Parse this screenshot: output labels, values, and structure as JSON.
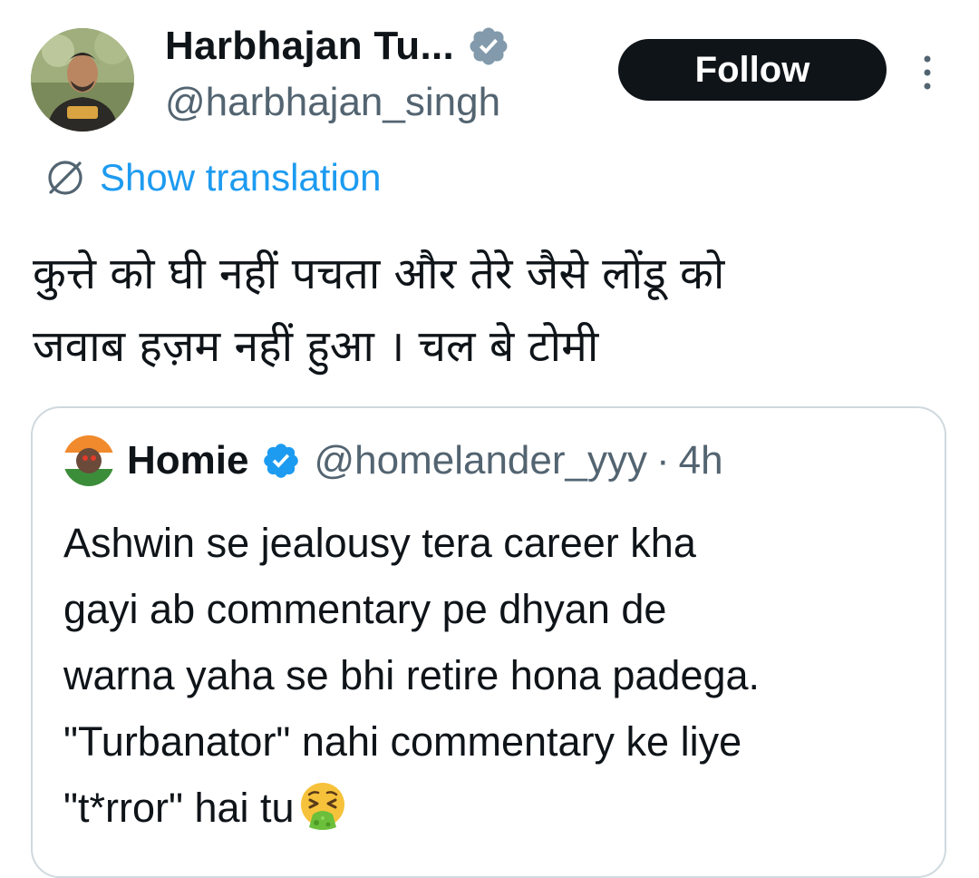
{
  "author": {
    "display_name": "Harbhajan Tu...",
    "handle": "@harbhajan_singh",
    "verified_badge": "gray-verified-icon",
    "avatar": "profile-photo"
  },
  "actions": {
    "follow_label": "Follow",
    "more_icon": "more-vertical-icon"
  },
  "translation": {
    "label": "Show translation",
    "icon": "globe-icon"
  },
  "tweet": {
    "text": "कुत्ते को घी नहीं पचता और तेरे जैसे लोंडू को\nजवाब हज़म नहीं हुआ । चल बे टोमी"
  },
  "quote": {
    "display_name": "Homie",
    "handle": "@homelander_yyy",
    "separator": "·",
    "time": "4h",
    "verified_badge": "blue-verified-icon",
    "text": "Ashwin se jealousy tera career kha\ngayi ab commentary pe dhyan de\nwarna yaha se bhi retire hona padega.\n\"Turbanator\" nahi commentary ke liye\n\"t*rror\" hai tu",
    "emoji": "vomiting-face-emoji"
  },
  "colors": {
    "text_primary": "#0f1419",
    "text_secondary": "#536471",
    "link": "#1d9bf0",
    "verified_blue": "#1d9bf0",
    "verified_gray": "#829aab",
    "border": "#cfd9de"
  }
}
